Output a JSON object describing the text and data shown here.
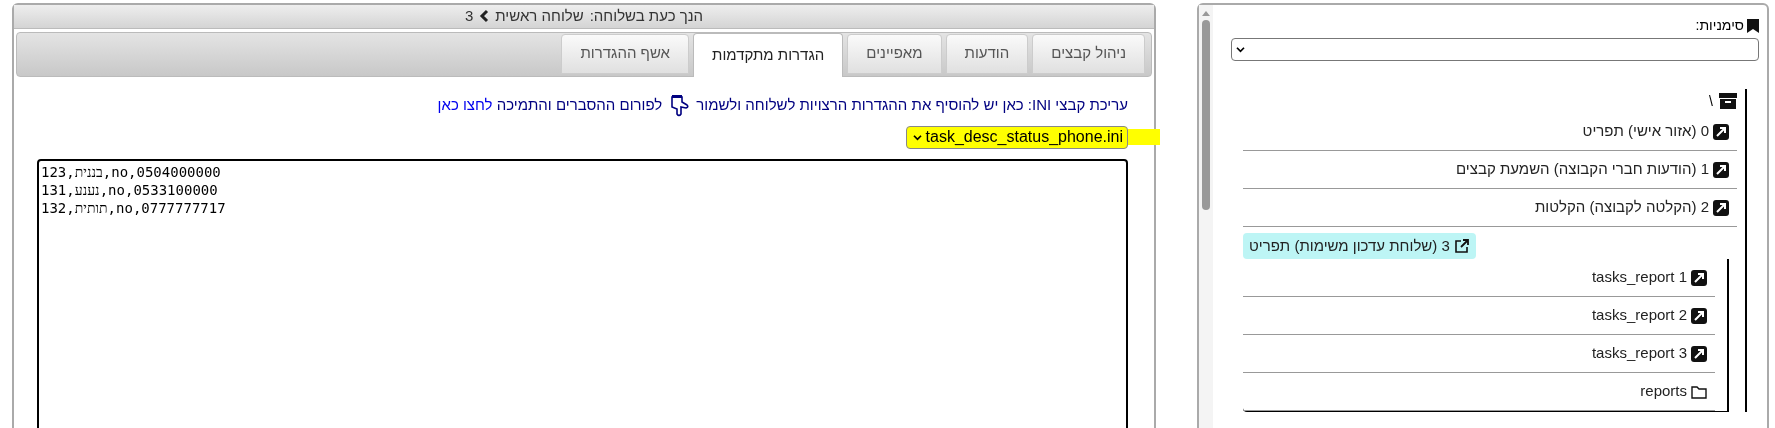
{
  "header": {
    "prefix": "הנך כעת בשלוחה:",
    "crumbs": [
      "שלוחה ראשית",
      "3"
    ]
  },
  "tabs": [
    {
      "label": "ניהול קבצים",
      "selected": false
    },
    {
      "label": "הודעות",
      "selected": false
    },
    {
      "label": "מאפיינים",
      "selected": false
    },
    {
      "label": "הגדרות מתקדמות",
      "selected": true
    },
    {
      "label": "אשף ההגדרות",
      "selected": false
    }
  ],
  "ini_notice": {
    "text": "עריכת קבצי INI: כאן יש להוסיף את ההגדרות הרצויות לשלוחה ולשמור",
    "forum_text": "לפורום ההסברים והתמיכה",
    "forum_link": "לחצו כאן"
  },
  "file_select": {
    "value": "task_desc_status_phone.ini",
    "highlighted": true
  },
  "editor": {
    "lines": [
      "123,בננית,no,0504000000",
      "131,נענע,no,0533100000",
      "132,תותית,no,0777777717"
    ]
  },
  "bookmarks": {
    "label": "סימניות:"
  },
  "tree": {
    "root": "\\",
    "items": [
      {
        "kind": "shortcut",
        "label": "0 (אזור אישי) תפריט",
        "selected": false
      },
      {
        "kind": "shortcut",
        "label": "1 (הודעות חברי הקבוצה) השמעת קבצים",
        "selected": false
      },
      {
        "kind": "shortcut",
        "label": "2 (הקלטה לקבוצה) הקלטות",
        "selected": false
      },
      {
        "kind": "current",
        "label": "3 (שלוחת עדכון משימות) תפריט",
        "selected": true,
        "children": [
          {
            "kind": "shortcut",
            "label": "tasks_report 1"
          },
          {
            "kind": "shortcut",
            "label": "tasks_report 2"
          },
          {
            "kind": "shortcut",
            "label": "tasks_report 3"
          },
          {
            "kind": "folder",
            "label": "reports"
          }
        ]
      }
    ]
  }
}
